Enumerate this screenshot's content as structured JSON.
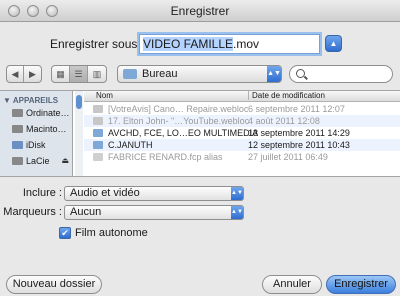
{
  "window": {
    "title": "Enregistrer"
  },
  "save_as": {
    "label": "Enregistrer sous :",
    "name_selected": "VIDEO FAMILLE",
    "extension": ".mov"
  },
  "location": {
    "folder": "Bureau"
  },
  "sidebar": {
    "header": "▼ APPAREILS",
    "items": [
      {
        "label": "Ordinate…",
        "icon": "computer-icon"
      },
      {
        "label": "Macinto…",
        "icon": "hard-drive-icon"
      },
      {
        "label": "iDisk",
        "icon": "idisk-icon"
      },
      {
        "label": "LaCie",
        "icon": "external-drive-icon"
      }
    ]
  },
  "files": {
    "columns": {
      "name": "Nom",
      "date": "Date de modification"
    },
    "rows": [
      {
        "name": "[VotreAvis] Cano… Repaire.webloc",
        "date": "6 septembre 2011 12:07",
        "enabled": false,
        "icon": "webloc-icon"
      },
      {
        "name": "17. Elton John- \"…YouTube.webloc",
        "date": "4 août 2011 12:08",
        "enabled": false,
        "icon": "webloc-icon"
      },
      {
        "name": "AVCHD, FCE, LO…EO MULTIMEDIA",
        "date": "13 septembre 2011 14:29",
        "enabled": true,
        "icon": "folder-icon"
      },
      {
        "name": "C.JANUTH",
        "date": "12 septembre 2011 10:43",
        "enabled": true,
        "icon": "folder-icon"
      },
      {
        "name": "FABRICE RENARD.fcp alias",
        "date": "27 juillet 2011 06:49",
        "enabled": false,
        "icon": "alias-icon"
      }
    ]
  },
  "export": {
    "include_label": "Inclure :",
    "include_value": "Audio et vidéo",
    "markers_label": "Marqueurs :",
    "markers_value": "Aucun",
    "self_contained_label": "Film autonome",
    "self_contained_checked": true
  },
  "buttons": {
    "new_folder": "Nouveau dossier",
    "cancel": "Annuler",
    "save": "Enregistrer"
  },
  "colors": {
    "accent": "#3b7fdd",
    "selection": "#b5d3ff",
    "sidebar": "#dde4ec"
  }
}
